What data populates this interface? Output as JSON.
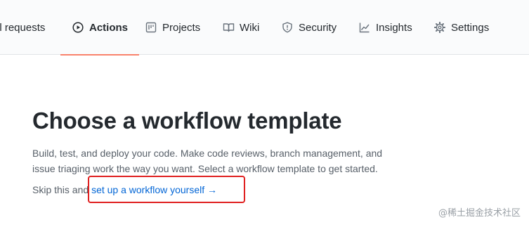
{
  "tabs": [
    {
      "label": "ll requests",
      "icon": "pull-request-icon"
    },
    {
      "label": "Actions",
      "icon": "play-icon",
      "active": true
    },
    {
      "label": "Projects",
      "icon": "project-board-icon"
    },
    {
      "label": "Wiki",
      "icon": "book-icon"
    },
    {
      "label": "Security",
      "icon": "shield-icon"
    },
    {
      "label": "Insights",
      "icon": "graph-icon"
    },
    {
      "label": "Settings",
      "icon": "gear-icon"
    }
  ],
  "main": {
    "title": "Choose a workflow template",
    "description": "Build, test, and deploy your code. Make code reviews, branch management, and issue triaging work the way you want. Select a workflow template to get started.",
    "skip_prefix": "Skip this and",
    "setup_link": "set up a workflow yourself →"
  },
  "watermark": "@稀土掘金技术社区",
  "colors": {
    "active_tab_underline": "#f9826c",
    "link": "#0366d6",
    "highlight_box": "#e02020"
  }
}
